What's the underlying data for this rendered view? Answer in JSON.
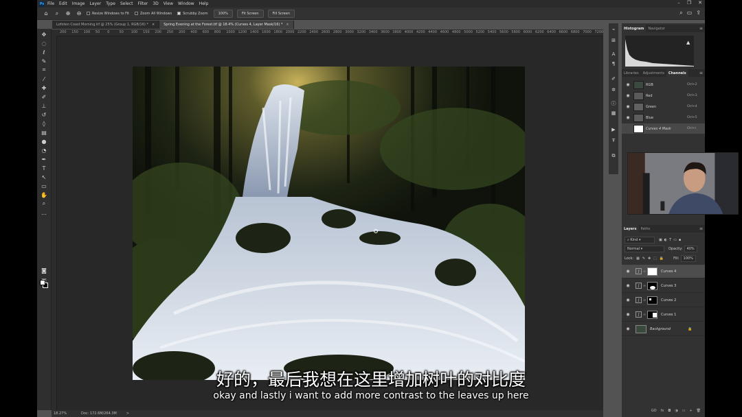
{
  "menu": [
    "File",
    "Edit",
    "Image",
    "Layer",
    "Type",
    "Select",
    "Filter",
    "3D",
    "View",
    "Window",
    "Help"
  ],
  "options": {
    "resize_windows": "Resize Windows to Fit",
    "zoom_all": "Zoom All Windows",
    "scrubby_zoom": "Scrubby Zoom",
    "zoom_value": "100%",
    "fit_screen": "Fit Screen",
    "fill_screen": "Fill Screen"
  },
  "tabs": [
    {
      "label": "Lofoten Coast Morning.tif @ 25% (Group 1, RGB/16) *"
    },
    {
      "label": "Spring Evening at the Forest.tif @ 18.4% (Curves 4, Layer Mask/16) *"
    }
  ],
  "ruler_ticks": [
    "200",
    "150",
    "100",
    "50",
    "0",
    "50",
    "100",
    "150",
    "200",
    "250",
    "200",
    "400",
    "600",
    "800",
    "1000",
    "1200",
    "1400",
    "1600",
    "1800",
    "2000",
    "2200",
    "2400",
    "2600",
    "2800",
    "3000",
    "3200",
    "3400",
    "3600",
    "3800",
    "4000",
    "4200",
    "4400",
    "4600",
    "4800",
    "5000",
    "5200",
    "5400",
    "5600",
    "5800",
    "6000",
    "6200",
    "6400",
    "6600",
    "6800",
    "7000",
    "7200"
  ],
  "status": {
    "zoom": "18.27%",
    "doc": "Doc: 172.6M/264.3M",
    "arrow": ">"
  },
  "panels": {
    "top_tabs": [
      "Histogram",
      "Navigator"
    ],
    "mid_tabs": [
      "Libraries",
      "Adjustments",
      "Channels"
    ],
    "channels": [
      {
        "name": "RGB",
        "shortcut": "Ctrl+2"
      },
      {
        "name": "Red",
        "shortcut": "Ctrl+3"
      },
      {
        "name": "Green",
        "shortcut": "Ctrl+4"
      },
      {
        "name": "Blue",
        "shortcut": "Ctrl+5"
      },
      {
        "name": "Curves 4 Mask",
        "shortcut": "Ctrl+\\"
      }
    ],
    "layers_tabs": [
      "Layers",
      "Paths"
    ],
    "kind": "Kind",
    "blend": "Normal",
    "opacity_label": "Opacity:",
    "opacity": "40%",
    "lock_label": "Lock:",
    "fill_label": "Fill:",
    "fill": "100%",
    "layers": [
      {
        "name": "Curves 4"
      },
      {
        "name": "Curves 3"
      },
      {
        "name": "Curves 2"
      },
      {
        "name": "Curves 1"
      },
      {
        "name": "Background"
      }
    ],
    "layers_bottom": [
      "GO",
      "fx",
      "◘",
      "◑",
      "▭",
      "+",
      "🗑"
    ]
  },
  "subtitles": {
    "zh": "好的，最后我想在这里增加树叶的对比度",
    "en": "okay and lastly i want to add more contrast to the leaves up here"
  }
}
